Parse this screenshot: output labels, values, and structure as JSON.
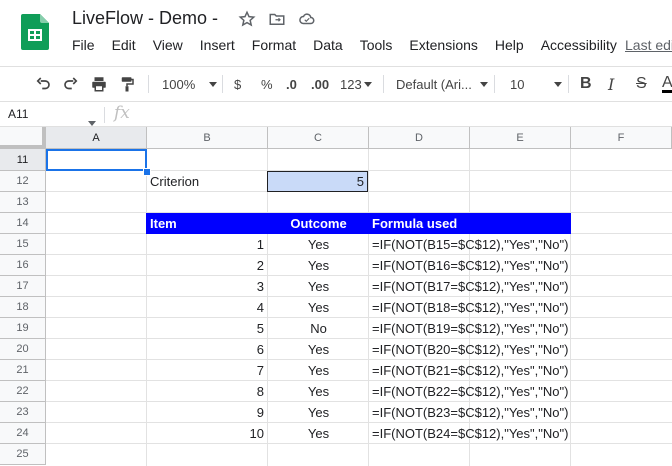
{
  "app": {
    "doc_title": "LiveFlow - Demo -",
    "last_edit": "Last edi",
    "menu": [
      "File",
      "Edit",
      "View",
      "Insert",
      "Format",
      "Data",
      "Tools",
      "Extensions",
      "Help",
      "Accessibility"
    ]
  },
  "toolbar": {
    "zoom": "100%",
    "currency": "$",
    "percent": "%",
    "dec_decrease": ".0",
    "dec_increase": ".00",
    "more_formats": "123",
    "font": "Default (Ari...",
    "font_size": "10",
    "bold": "B",
    "italic": "I",
    "strike": "S",
    "text_color": "A"
  },
  "formula_bar": {
    "name_box": "A11",
    "fx": "fx",
    "formula": ""
  },
  "grid": {
    "columns": [
      "A",
      "B",
      "C",
      "D",
      "E",
      "F"
    ],
    "rows": [
      "11",
      "12",
      "13",
      "14",
      "15",
      "16",
      "17",
      "18",
      "19",
      "20",
      "21",
      "22",
      "23",
      "24",
      "25"
    ],
    "criterion_label": "Criterion",
    "criterion_value": "5",
    "table_headers": {
      "item": "Item",
      "outcome": "Outcome",
      "formula": "Formula used"
    },
    "table_rows": [
      {
        "item": "1",
        "outcome": "Yes",
        "formula": "=IF(NOT(B15=$C$12),\"Yes\",\"No\")"
      },
      {
        "item": "2",
        "outcome": "Yes",
        "formula": "=IF(NOT(B16=$C$12),\"Yes\",\"No\")"
      },
      {
        "item": "3",
        "outcome": "Yes",
        "formula": "=IF(NOT(B17=$C$12),\"Yes\",\"No\")"
      },
      {
        "item": "4",
        "outcome": "Yes",
        "formula": "=IF(NOT(B18=$C$12),\"Yes\",\"No\")"
      },
      {
        "item": "5",
        "outcome": "No",
        "formula": "=IF(NOT(B19=$C$12),\"Yes\",\"No\")"
      },
      {
        "item": "6",
        "outcome": "Yes",
        "formula": "=IF(NOT(B20=$C$12),\"Yes\",\"No\")"
      },
      {
        "item": "7",
        "outcome": "Yes",
        "formula": "=IF(NOT(B21=$C$12),\"Yes\",\"No\")"
      },
      {
        "item": "8",
        "outcome": "Yes",
        "formula": "=IF(NOT(B22=$C$12),\"Yes\",\"No\")"
      },
      {
        "item": "9",
        "outcome": "Yes",
        "formula": "=IF(NOT(B23=$C$12),\"Yes\",\"No\")"
      },
      {
        "item": "10",
        "outcome": "Yes",
        "formula": "=IF(NOT(B24=$C$12),\"Yes\",\"No\")"
      }
    ]
  },
  "colors": {
    "header_fill": "#0000ff",
    "criterion_fill": "#c9daf8",
    "selection": "#1a73e8",
    "sheets_green": "#0f9d58"
  }
}
